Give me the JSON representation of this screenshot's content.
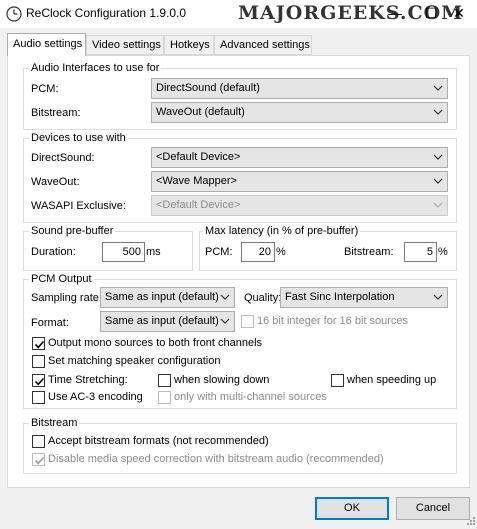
{
  "window": {
    "title": "ReClock Configuration 1.9.0.0",
    "watermark": "MAJORGEEKS.COM",
    "app_icon": "reclock-clock-icon",
    "minimize_glyph": "—",
    "maximize_glyph": "☐",
    "close_glyph": "✕"
  },
  "tabs": [
    {
      "label": "Audio settings",
      "active": true
    },
    {
      "label": "Video settings"
    },
    {
      "label": "Hotkeys"
    },
    {
      "label": "Advanced settings"
    }
  ],
  "audio_interfaces": {
    "group_label": "Audio Interfaces to use for",
    "pcm_label": "PCM:",
    "pcm_value": "DirectSound (default)",
    "bitstream_label": "Bitstream:",
    "bitstream_value": "WaveOut (default)"
  },
  "devices": {
    "group_label": "Devices to use with",
    "directsound_label": "DirectSound:",
    "directsound_value": "<Default Device>",
    "waveout_label": "WaveOut:",
    "waveout_value": "<Wave Mapper>",
    "wasapi_label": "WASAPI Exclusive:",
    "wasapi_value": "<Default Device>"
  },
  "prebuffer": {
    "group_label": "Sound pre-buffer",
    "duration_label": "Duration:",
    "duration_value": "500",
    "duration_unit": "ms"
  },
  "latency": {
    "group_label": "Max latency (in % of pre-buffer)",
    "pcm_label": "PCM:",
    "pcm_value": "20",
    "pcm_unit": "%",
    "bitstream_label": "Bitstream:",
    "bitstream_value": "5",
    "bitstream_unit": "%"
  },
  "pcm_output": {
    "group_label": "PCM Output",
    "sampling_label": "Sampling rate:",
    "sampling_value": "Same as input (default)",
    "quality_label": "Quality:",
    "quality_value": "Fast Sinc Interpolation",
    "format_label": "Format:",
    "format_value": "Same as input (default)",
    "bit16_label": "16 bit integer for 16 bit sources",
    "mono_label": "Output mono sources to both front channels",
    "speaker_label": "Set matching speaker configuration",
    "stretch_label": "Time Stretching:",
    "slowing_label": "when slowing down",
    "speeding_label": "when speeding up",
    "ac3_label": "Use AC-3 encoding",
    "multichannel_label": "only with multi-channel sources"
  },
  "bitstream": {
    "group_label": "Bitstream",
    "accept_label": "Accept bitstream formats (not recommended)",
    "disable_label": "Disable media speed correction with bitstream audio (recommended)"
  },
  "buttons": {
    "ok": "OK",
    "cancel": "Cancel"
  }
}
